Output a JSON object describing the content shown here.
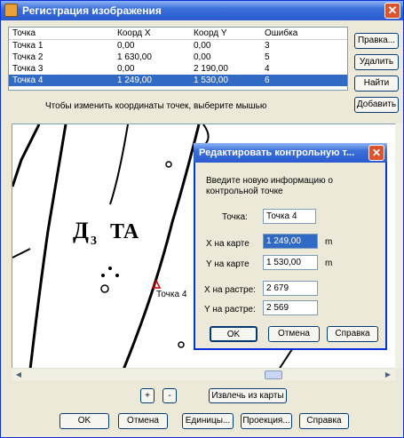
{
  "window": {
    "title": "Регистрация изображения",
    "close_icon": "close-icon"
  },
  "table": {
    "columns": [
      "Точка",
      "Коорд X",
      "Коорд Y",
      "Ошибка"
    ],
    "rows": [
      {
        "name": "Точка 1",
        "x": "0,00",
        "y": "0,00",
        "err": "3"
      },
      {
        "name": "Точка 2",
        "x": "1 630,00",
        "y": "0,00",
        "err": "5"
      },
      {
        "name": "Точка 3",
        "x": "0,00",
        "y": "2 190,00",
        "err": "4"
      },
      {
        "name": "Точка 4",
        "x": "1 249,00",
        "y": "1 530,00",
        "err": "6"
      }
    ],
    "selected_index": 3
  },
  "side_buttons": {
    "edit": "Правка...",
    "delete": "Удалить",
    "find": "Найти",
    "add": "Добавить"
  },
  "hint": "Чтобы изменить координаты точек, выберите мышью",
  "map": {
    "point_label": "Точка 4",
    "map_texts": [
      "Д",
      "3",
      "ТА"
    ]
  },
  "dialog": {
    "title": "Редактировать контрольную т...",
    "intro": "Введите новую информацию о контрольной точке",
    "point_label": "Точка:",
    "point_value": "Точка 4",
    "x_map_label": "X на карте",
    "x_map_value": "1 249,00",
    "x_map_unit": "m",
    "y_map_label": "Y на карте",
    "y_map_value": "1 530,00",
    "y_map_unit": "m",
    "x_raster_label": "X на растре:",
    "x_raster_value": "2 679",
    "y_raster_label": "Y на растре:",
    "y_raster_value": "2 569",
    "ok": "OK",
    "cancel": "Отмена",
    "help": "Справка"
  },
  "zoom": {
    "in": "+",
    "out": "-"
  },
  "extract_button": "Извлечь из карты",
  "bottom_buttons": {
    "ok": "OK",
    "cancel": "Отмена",
    "units": "Единицы...",
    "projection": "Проекция...",
    "help": "Справка"
  },
  "colors": {
    "title_bar": "#2a5bd0",
    "selection": "#316ac5",
    "close": "#d9532c"
  }
}
